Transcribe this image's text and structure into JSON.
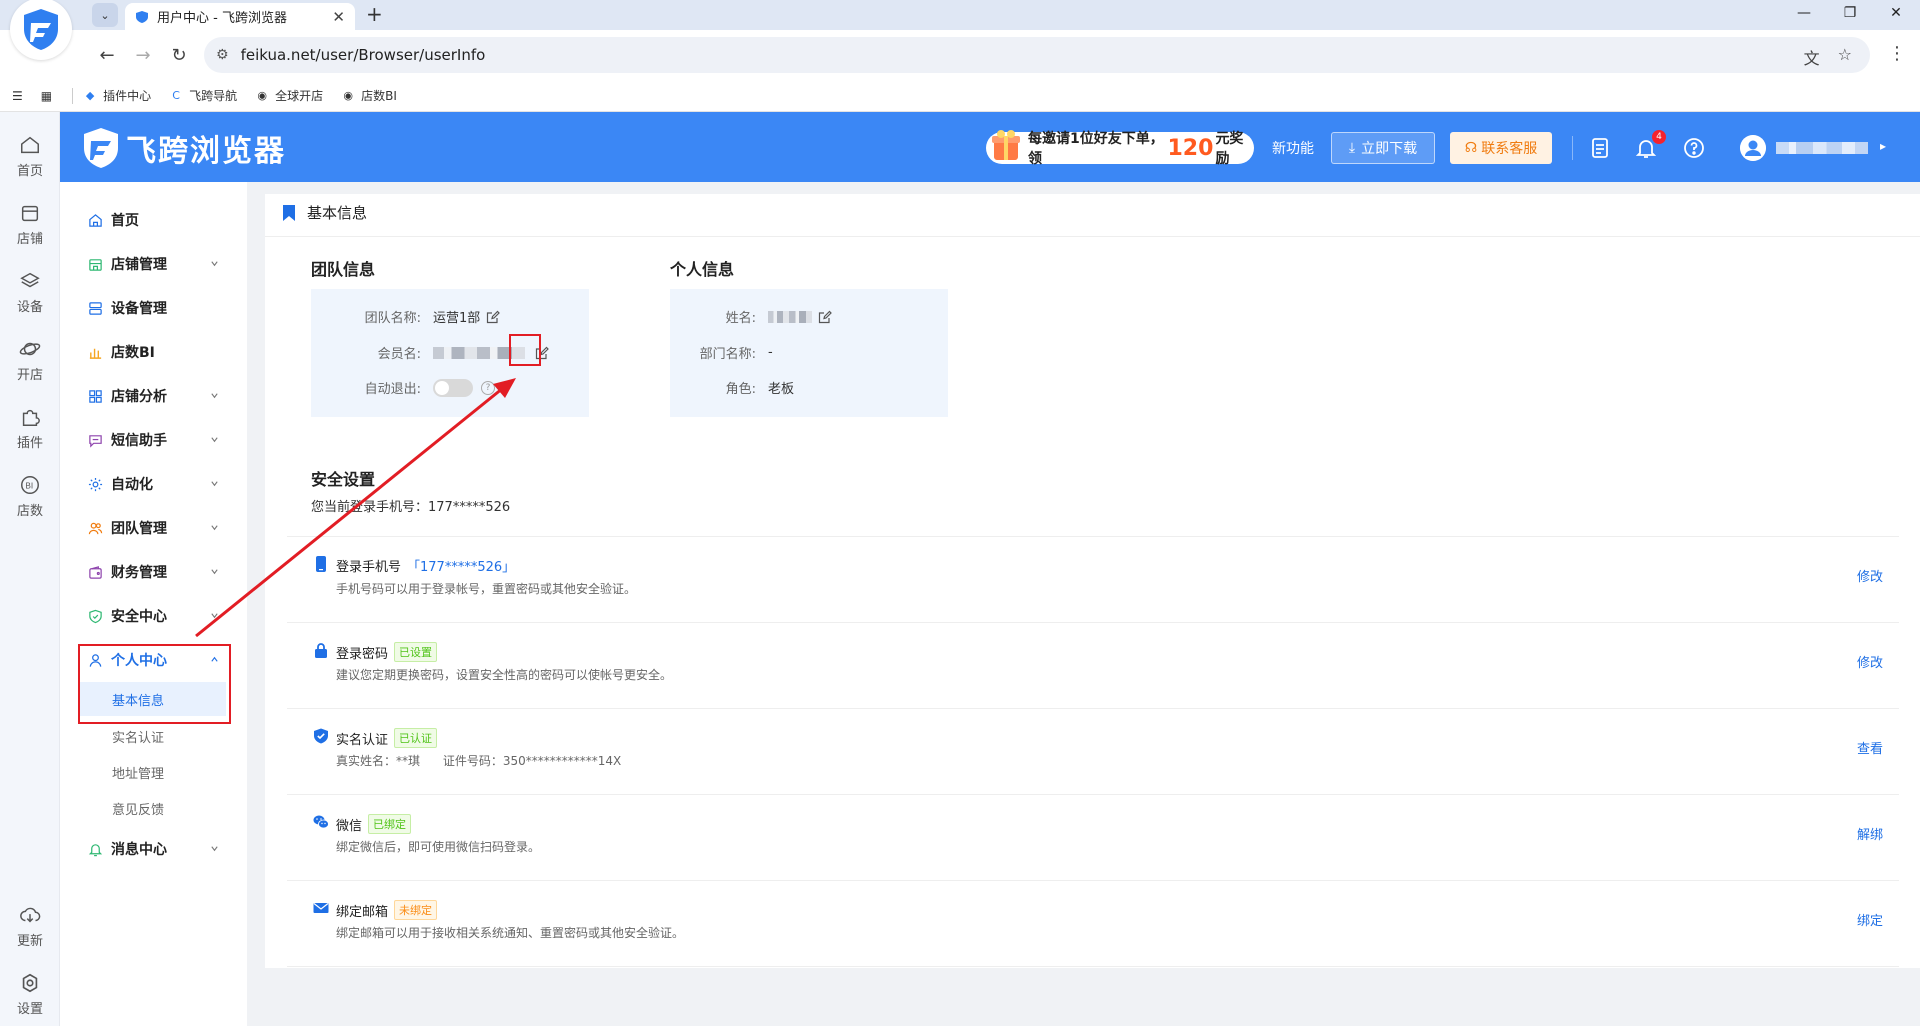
{
  "browser": {
    "tab_title": "用户中心 - 飞跨浏览器",
    "tab_close": "✕",
    "new_tab": "+",
    "url": "feikua.net/user/Browser/userInfo",
    "window_controls": [
      "—",
      "❐",
      "✕"
    ],
    "bookmarks": [
      "插件中心",
      "飞跨导航",
      "全球开店",
      "店数BI"
    ]
  },
  "rail": {
    "items": [
      "首页",
      "店铺",
      "设备",
      "开店",
      "插件",
      "店数"
    ],
    "bottom": [
      "更新",
      "设置"
    ]
  },
  "header": {
    "brand": "飞跨浏览器",
    "promo_prefix": "每邀请1位好友下单，领",
    "promo_amount": "120",
    "promo_suffix": "元奖励",
    "new_feature": "新功能",
    "download": "立即下载",
    "contact": "联系客服",
    "notification_count": "4"
  },
  "menu": {
    "items": [
      {
        "label": "首页"
      },
      {
        "label": "店铺管理"
      },
      {
        "label": "设备管理"
      },
      {
        "label": "店数BI"
      },
      {
        "label": "店铺分析"
      },
      {
        "label": "短信助手"
      },
      {
        "label": "自动化"
      },
      {
        "label": "团队管理"
      },
      {
        "label": "财务管理"
      },
      {
        "label": "安全中心"
      },
      {
        "label": "个人中心"
      },
      {
        "label": "消息中心"
      }
    ],
    "sub_items": [
      "基本信息",
      "实名认证",
      "地址管理",
      "意见反馈"
    ]
  },
  "content": {
    "title": "基本信息",
    "team": {
      "heading": "团队信息",
      "name_label": "团队名称:",
      "name_value": "运营1部",
      "member_label": "会员名:",
      "auto_logout_label": "自动退出:",
      "help": "?"
    },
    "personal": {
      "heading": "个人信息",
      "name_label": "姓名:",
      "dept_label": "部门名称:",
      "dept_value": "-",
      "role_label": "角色:",
      "role_value": "老板"
    },
    "security": {
      "heading": "安全设置",
      "current_phone": "您当前登录手机号：177*****526",
      "items": [
        {
          "name": "登录手机号",
          "extra": "「177*****526」",
          "desc": "手机号码可以用于登录帐号，重置密码或其他安全验证。",
          "action": "修改"
        },
        {
          "name": "登录密码",
          "tag": "已设置",
          "desc": "建议您定期更换密码，设置安全性高的密码可以使帐号更安全。",
          "action": "修改"
        },
        {
          "name": "实名认证",
          "tag": "已认证",
          "desc": "真实姓名：**琪      证件号码：350************14X",
          "action": "查看"
        },
        {
          "name": "微信",
          "tag": "已绑定",
          "desc": "绑定微信后，即可使用微信扫码登录。",
          "action": "解绑"
        },
        {
          "name": "绑定邮箱",
          "tag": "未绑定",
          "desc": "绑定邮箱可以用于接收相关系统通知、重置密码或其他安全验证。",
          "action": "绑定"
        }
      ]
    }
  },
  "colors": {
    "header_blue": "#3b87f5",
    "link_blue": "#1f6fe5",
    "annotation_red": "#e21d24"
  }
}
